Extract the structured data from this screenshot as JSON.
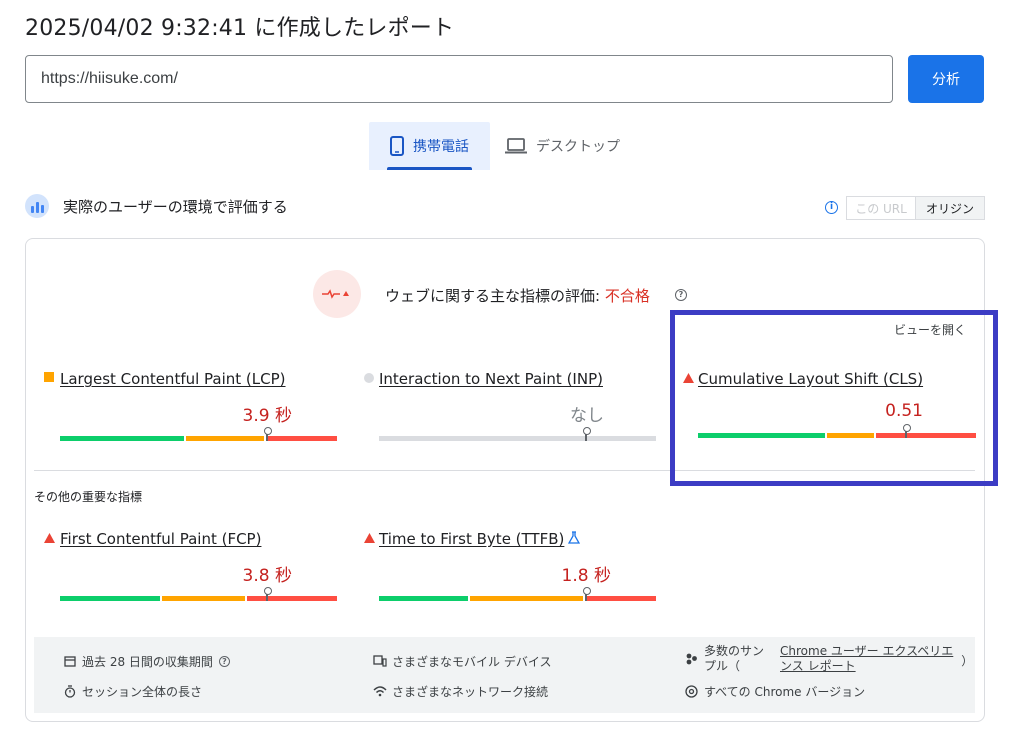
{
  "report": {
    "title": "2025/04/02 9:32:41 に作成したレポート"
  },
  "search": {
    "url": "https://hiisuke.com/",
    "analyze_label": "分析"
  },
  "tabs": {
    "mobile": "携帯電話",
    "desktop": "デスクトップ"
  },
  "field": {
    "title": "実際のユーザーの環境で評価する",
    "toggle_url": "この URL",
    "toggle_origin": "オリジン"
  },
  "assessment": {
    "label": "ウェブに関する主な指標の評価: ",
    "result": "不合格",
    "view_open": "ビューを開く"
  },
  "metrics": [
    {
      "name": "Largest Contentful Paint (LCP)",
      "value": "3.9 秒",
      "status": "needs-improvement",
      "distribution": [
        0.45,
        0.3,
        0.25
      ],
      "marker_position": 0.745
    },
    {
      "name": "Interaction to Next Paint (INP)",
      "value": "なし",
      "status": "no-data",
      "marker_position": 0.745
    },
    {
      "name": "Cumulative Layout Shift (CLS)",
      "value": "0.51",
      "status": "poor",
      "distribution": [
        0.46,
        0.17,
        0.37
      ],
      "marker_position": 0.745
    }
  ],
  "other": {
    "title": "その他の重要な指標",
    "metrics": [
      {
        "name": "First Contentful Paint (FCP)",
        "value": "3.8 秒",
        "status": "poor",
        "distribution": [
          0.36,
          0.3,
          0.34
        ],
        "marker_position": 0.745
      },
      {
        "name": "Time to First Byte (TTFB)",
        "value": "1.8 秒",
        "status": "poor",
        "distribution": [
          0.32,
          0.41,
          0.27
        ],
        "marker_position": 0.745
      }
    ]
  },
  "footer": {
    "period": "過去 28 日間の収集期間",
    "session": "セッション全体の長さ",
    "devices": "さまざまなモバイル デバイス",
    "network": "さまざまなネットワーク接続",
    "samples_prefix": "多数のサン",
    "samples_prefix2": "プル（",
    "samples_link1": "Chrome ユーザー エクスペリエ",
    "samples_link2": "ンス レポート",
    "samples_suffix": "）",
    "chrome_versions": "すべての Chrome バージョン"
  },
  "colors": {
    "good": "#0cce6b",
    "needs_improvement": "#ffa400",
    "poor": "#ff4e42",
    "accent": "#1a73e8"
  }
}
